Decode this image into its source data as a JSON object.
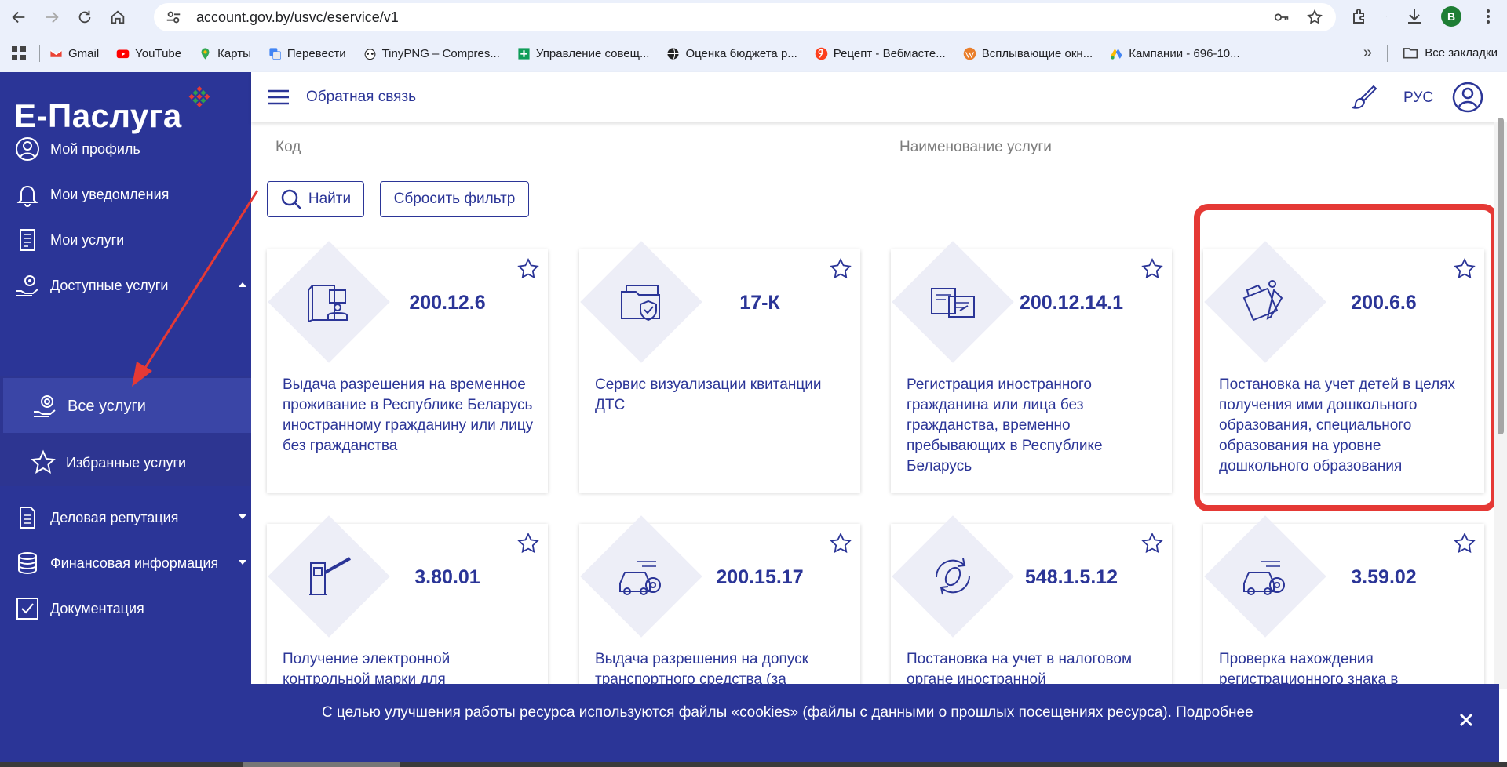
{
  "browser": {
    "url": "account.gov.by/usvc/eservice/v1",
    "profile_initial": "B",
    "bookmarks": [
      {
        "label": "Gmail",
        "icon": "gmail-icon"
      },
      {
        "label": "YouTube",
        "icon": "youtube-icon"
      },
      {
        "label": "Карты",
        "icon": "maps-icon"
      },
      {
        "label": "Перевести",
        "icon": "translate-icon"
      },
      {
        "label": "TinyPNG – Compres...",
        "icon": "panda-icon"
      },
      {
        "label": "Управление совещ...",
        "icon": "plus-green-icon"
      },
      {
        "label": "Оценка бюджета р...",
        "icon": "globe-icon"
      },
      {
        "label": "Рецепт - Вебмасте...",
        "icon": "yandex-icon"
      },
      {
        "label": "Всплывающие окн...",
        "icon": "wordpress-icon"
      },
      {
        "label": "Кампании - 696-10...",
        "icon": "google-ads-icon"
      }
    ],
    "more_bookmarks": "»",
    "all_bookmarks": "Все закладки"
  },
  "sidebar": {
    "logo": "Е-Паслуга",
    "items": [
      {
        "label": "Мой профиль",
        "icon": "user-circle-icon"
      },
      {
        "label": "Мои уведомления",
        "icon": "bell-icon"
      },
      {
        "label": "Мои услуги",
        "icon": "document-list-icon"
      },
      {
        "label": "Доступные услуги",
        "icon": "hand-gear-icon"
      },
      {
        "label": "Все услуги",
        "icon": "hand-gear-icon"
      },
      {
        "label": "Избранные услуги",
        "icon": "star-icon"
      },
      {
        "label": "Деловая репутация",
        "icon": "document-icon"
      },
      {
        "label": "Финансовая информация",
        "icon": "database-icon"
      },
      {
        "label": "Документация",
        "icon": "checkbox-icon"
      }
    ]
  },
  "topbar": {
    "feedback": "Обратная связь",
    "lang": "РУС"
  },
  "filters": {
    "code_placeholder": "Код",
    "name_placeholder": "Наименование услуги",
    "search_label": "Найти",
    "reset_label": "Сбросить фильтр"
  },
  "services": [
    {
      "code": "200.12.6",
      "title": "Выдача разрешения на временное проживание в Республике Беларусь иностранному гражданину или лицу без гражданства",
      "icon": "residence-permit-icon"
    },
    {
      "code": "17-К",
      "title": "Сервис визуализации квитанции ДТС",
      "icon": "folder-shield-icon"
    },
    {
      "code": "200.12.14.1",
      "title": "Регистрация иностранного гражданина или лица без гражданства, временно пребывающих в Республике Беларусь",
      "icon": "registration-documents-icon"
    },
    {
      "code": "200.6.6",
      "title": "Постановка на учет детей в целях получения ими дошкольного образования, специального образования на уровне дошкольного образования",
      "icon": "folder-pen-icon"
    },
    {
      "code": "3.80.01",
      "title": "Получение электронной контрольной марки для",
      "icon": "barrier-icon"
    },
    {
      "code": "200.15.17",
      "title": "Выдача разрешения на допуск транспортного средства (за",
      "icon": "car-gear-icon"
    },
    {
      "code": "548.1.5.12",
      "title": "Постановка на учет в налоговом органе иностранной",
      "icon": "coin-cycle-icon"
    },
    {
      "code": "3.59.02",
      "title": "Проверка нахождения регистрационного знака в",
      "icon": "car-gear-icon"
    }
  ],
  "cookie": {
    "text": "С целью улучшения работы ресурса используются файлы «cookies» (файлы с данными о прошлых посещениях ресурса). ",
    "more": "Подробнее"
  },
  "colors": {
    "brand": "#2b3597",
    "highlight": "#e53935"
  }
}
